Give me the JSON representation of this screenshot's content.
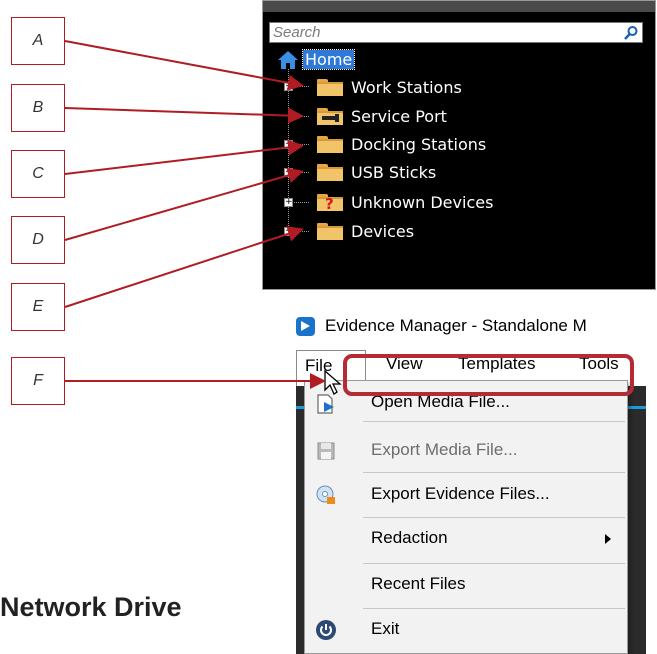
{
  "colors": {
    "callout_red": "#b01c24",
    "tree_background": "#000000",
    "home_highlight": "#2e78d8",
    "folder": "#f2c46a",
    "menu_highlight_border": "#b32b34",
    "app_logo_blue": "#1a73c9"
  },
  "callouts": [
    "A",
    "B",
    "C",
    "D",
    "E",
    "F"
  ],
  "tree": {
    "search_placeholder": "Search",
    "search_icon": "magnifier-icon",
    "home": {
      "label": "Home",
      "icon": "home-icon"
    },
    "items": [
      {
        "label": "Work Stations",
        "icon": "folder-icon",
        "expandable": true
      },
      {
        "label": "Service Port",
        "icon": "service-port-folder-icon",
        "expandable": false
      },
      {
        "label": "Docking Stations",
        "icon": "folder-icon",
        "expandable": true
      },
      {
        "label": "USB Sticks",
        "icon": "folder-icon",
        "expandable": true
      },
      {
        "label": "Unknown Devices",
        "icon": "unknown-folder-icon",
        "expandable": true
      },
      {
        "label": "Devices",
        "icon": "folder-icon",
        "expandable": true
      }
    ]
  },
  "app": {
    "title": "Evidence Manager - Standalone M",
    "menus": [
      "File",
      "View",
      "Templates",
      "Tools"
    ],
    "file_menu": [
      {
        "label": "Open Media File...",
        "icon": "open-media-icon",
        "disabled": false
      },
      {
        "label": "Export Media File...",
        "icon": "save-disk-icon",
        "disabled": true
      },
      {
        "label": "Export Evidence Files...",
        "icon": "export-disc-icon",
        "disabled": false
      },
      {
        "label": "Redaction",
        "icon": "",
        "disabled": false,
        "submenu": true
      },
      {
        "label": "Recent Files",
        "icon": "",
        "disabled": false
      },
      {
        "label": "Exit",
        "icon": "power-icon",
        "disabled": false
      }
    ]
  },
  "footer_heading": "Network Drive"
}
